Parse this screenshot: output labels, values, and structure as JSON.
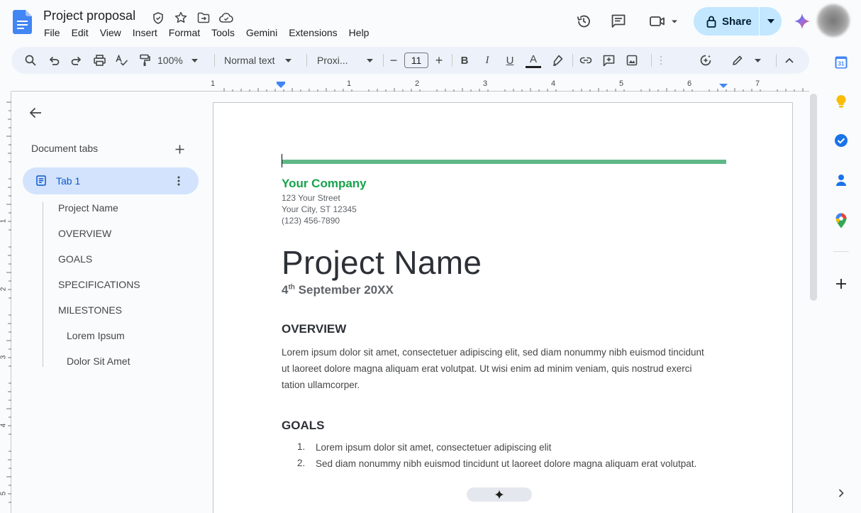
{
  "doc": {
    "title": "Project proposal"
  },
  "menu": [
    "File",
    "Edit",
    "View",
    "Insert",
    "Format",
    "Tools",
    "Gemini",
    "Extensions",
    "Help"
  ],
  "share": {
    "label": "Share"
  },
  "toolbar": {
    "zoom": "100%",
    "style": "Normal text",
    "font": "Proxi...",
    "font_size": "11",
    "minus": "−",
    "plus": "+",
    "bold": "B",
    "italic": "I",
    "underline": "U",
    "text_color": "A"
  },
  "ruler": {
    "h_numbers": [
      "1",
      "1",
      "2",
      "3",
      "4",
      "5",
      "6",
      "7"
    ],
    "v_numbers": [
      "1",
      "2",
      "3",
      "4",
      "5"
    ]
  },
  "doc_tabs": {
    "title": "Document tabs",
    "tab": "Tab 1",
    "outline": [
      "Project Name",
      "OVERVIEW",
      "GOALS",
      "SPECIFICATIONS",
      "MILESTONES",
      "Lorem Ipsum",
      "Dolor Sit Amet"
    ]
  },
  "page": {
    "company": "Your Company",
    "address": [
      "123 Your Street",
      "Your City, ST 12345",
      "(123) 456-7890"
    ],
    "project_name": "Project Name",
    "date_day": "4",
    "date_suffix": "th",
    "date_rest": " September 20XX",
    "overview_heading": "OVERVIEW",
    "overview_text": "Lorem ipsum dolor sit amet, consectetuer adipiscing elit, sed diam nonummy nibh euismod tincidunt ut laoreet dolore magna aliquam erat volutpat. Ut wisi enim ad minim veniam, quis nostrud exerci tation ullamcorper.",
    "goals_heading": "GOALS",
    "goals": [
      {
        "num": "1.",
        "text": "Lorem ipsum dolor sit amet, consectetuer adipiscing elit"
      },
      {
        "num": "2.",
        "text": "Sed diam nonummy nibh euismod tincidunt ut laoreet dolore magna aliquam erat volutpat."
      }
    ]
  },
  "colors": {
    "accent_green": "#60b787",
    "company_green": "#16a34a",
    "share_bg": "#c2e7ff",
    "tab_active_bg": "#d3e3fd"
  },
  "icons": [
    "docs-logo",
    "shield-icon",
    "star-icon",
    "move-folder-icon",
    "cloud-icon",
    "history-icon",
    "comment-icon",
    "meet-icon",
    "lock-icon",
    "gemini-icon",
    "calendar-icon",
    "keep-icon",
    "tasks-icon",
    "contacts-icon",
    "maps-icon"
  ]
}
